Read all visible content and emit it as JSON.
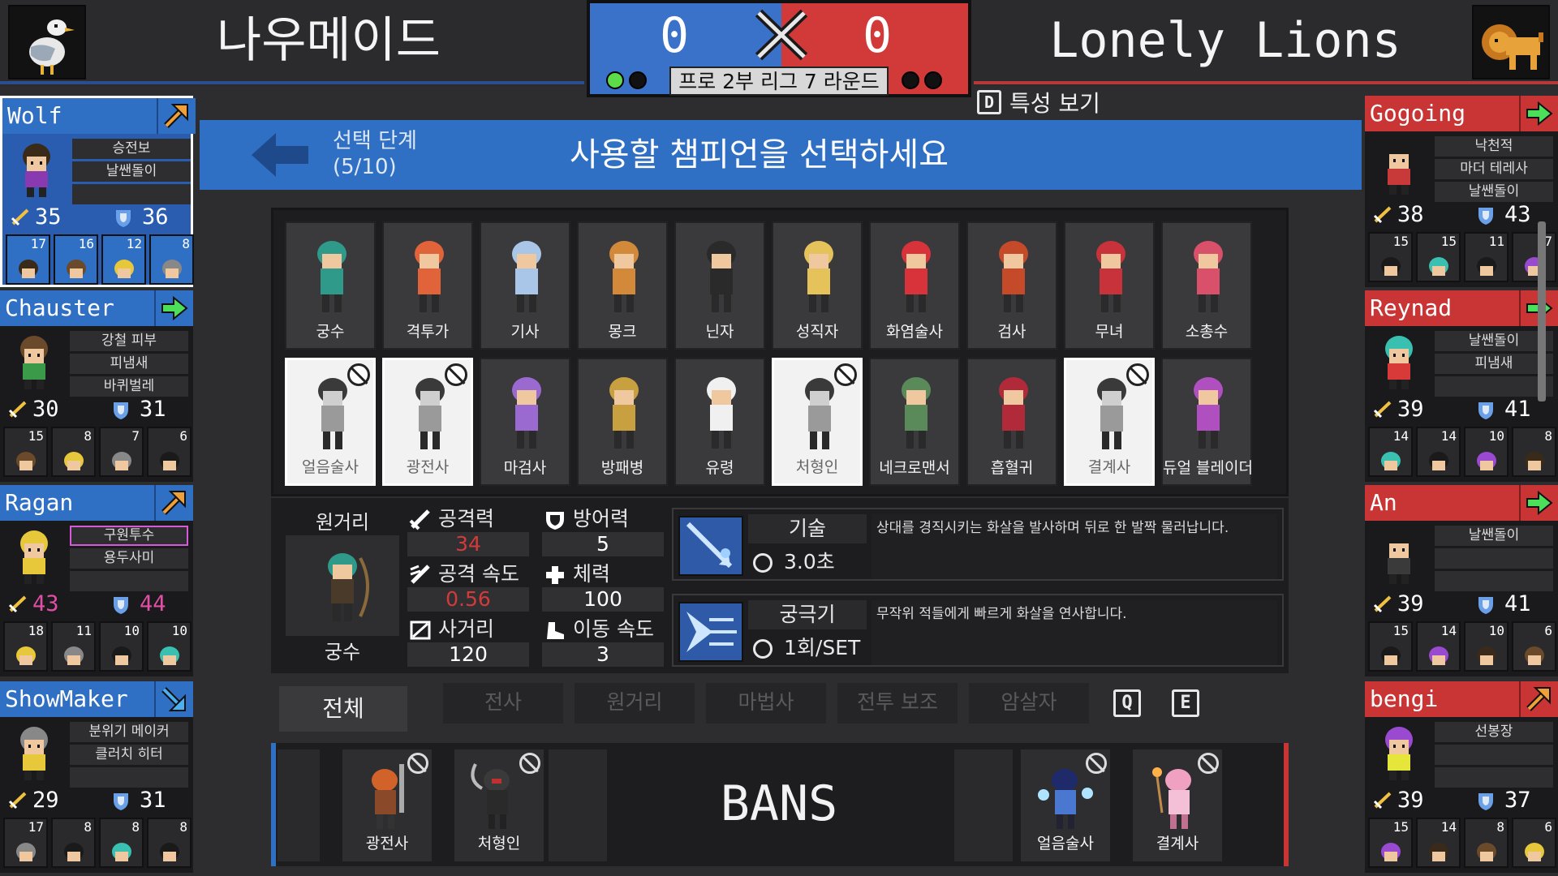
{
  "match": {
    "left_team": "나우메이드",
    "right_team": "Lonely Lions",
    "left_score": "0",
    "right_score": "0",
    "round_label": "프로 2부 리그 7 라운드",
    "traits_key": "D",
    "traits_label": "특성 보기",
    "colors": {
      "blue": "#2f6fc4",
      "red": "#c93535",
      "green_dot": "#5cdc4a"
    }
  },
  "header": {
    "phase_title": "선택 단계",
    "phase_progress": "(5/10)",
    "prompt": "사용할 챔피언을 선택하세요"
  },
  "left_players": [
    {
      "name": "Wolf",
      "status_icon": "arrow-up-right-icon",
      "traits": [
        "승전보",
        "날쌘돌이",
        ""
      ],
      "atk": "35",
      "def": "36",
      "champs": [
        "17",
        "16",
        "12",
        "8"
      ]
    },
    {
      "name": "Chauster",
      "status_icon": "arrow-right-icon",
      "traits": [
        "강철 피부",
        "피냄새",
        "바퀴벌레"
      ],
      "atk": "30",
      "def": "31",
      "champs": [
        "15",
        "8",
        "7",
        "6"
      ]
    },
    {
      "name": "Ragan",
      "status_icon": "arrow-up-right-icon",
      "traits": [
        "구원투수",
        "용두사미",
        ""
      ],
      "atk": "43",
      "def": "44",
      "champs": [
        "18",
        "11",
        "10",
        "10"
      ]
    },
    {
      "name": "ShowMaker",
      "status_icon": "arrow-down-right-icon",
      "traits": [
        "분위기 메이커",
        "클러치 히터",
        ""
      ],
      "atk": "29",
      "def": "31",
      "champs": [
        "17",
        "8",
        "8",
        "8"
      ]
    }
  ],
  "right_players": [
    {
      "name": "Gogoing",
      "status_icon": "arrow-right-icon",
      "traits": [
        "낙천적",
        "마더 테레사",
        "날쌘돌이"
      ],
      "atk": "38",
      "def": "43",
      "champs": [
        "15",
        "15",
        "11",
        "7"
      ]
    },
    {
      "name": "Reynad",
      "status_icon": "arrow-right-icon",
      "traits": [
        "날쌘돌이",
        "피냄새",
        ""
      ],
      "atk": "39",
      "def": "41",
      "champs": [
        "14",
        "14",
        "10",
        "8"
      ]
    },
    {
      "name": "An",
      "status_icon": "arrow-right-icon",
      "traits": [
        "날쌘돌이",
        "",
        ""
      ],
      "atk": "39",
      "def": "41",
      "champs": [
        "15",
        "14",
        "10",
        "6"
      ]
    },
    {
      "name": "bengi",
      "status_icon": "arrow-up-right-icon",
      "traits": [
        "선봉장",
        "",
        ""
      ],
      "atk": "39",
      "def": "37",
      "champs": [
        "15",
        "14",
        "8",
        "6"
      ]
    }
  ],
  "champions": [
    {
      "name": "궁수",
      "banned": false,
      "color": "#2f9a8a"
    },
    {
      "name": "격투가",
      "banned": false,
      "color": "#e0633a"
    },
    {
      "name": "기사",
      "banned": false,
      "color": "#a9c6e8"
    },
    {
      "name": "몽크",
      "banned": false,
      "color": "#d28a3a"
    },
    {
      "name": "닌자",
      "banned": false,
      "color": "#2a2a2a"
    },
    {
      "name": "성직자",
      "banned": false,
      "color": "#e6c25a"
    },
    {
      "name": "화염술사",
      "banned": false,
      "color": "#d8323a"
    },
    {
      "name": "검사",
      "banned": false,
      "color": "#c44a2a"
    },
    {
      "name": "무녀",
      "banned": false,
      "color": "#c8323a"
    },
    {
      "name": "소총수",
      "banned": false,
      "color": "#d8506a"
    },
    {
      "name": "얼음술사",
      "banned": true,
      "color": "#555555"
    },
    {
      "name": "광전사",
      "banned": true,
      "color": "#555555"
    },
    {
      "name": "마검사",
      "banned": false,
      "color": "#9a6ad0"
    },
    {
      "name": "방패병",
      "banned": false,
      "color": "#c8a040"
    },
    {
      "name": "유령",
      "banned": false,
      "color": "#f0f0f0"
    },
    {
      "name": "처형인",
      "banned": true,
      "color": "#555555"
    },
    {
      "name": "네크로맨서",
      "banned": false,
      "color": "#5a8a5a"
    },
    {
      "name": "흡혈귀",
      "banned": false,
      "color": "#b02a3a"
    },
    {
      "name": "결계사",
      "banned": true,
      "color": "#777777"
    },
    {
      "name": "듀얼 블레이더",
      "banned": false,
      "color": "#b050c0"
    }
  ],
  "detail": {
    "category": "원거리",
    "class_name": "궁수",
    "stats": {
      "atk_label": "공격력",
      "atk": "34",
      "def_label": "방어력",
      "def": "5",
      "aspd_label": "공격 속도",
      "aspd": "0.56",
      "hp_label": "체력",
      "hp": "100",
      "range_label": "사거리",
      "range": "120",
      "move_label": "이동 속도",
      "move": "3"
    },
    "skill": {
      "label": "기술",
      "cooldown": "3.0초",
      "desc": "상대를 경직시키는 화살을 발사하며 뒤로 한 발짝 물러납니다."
    },
    "ult": {
      "label": "궁극기",
      "cooldown": "1회/SET",
      "desc": "무작위 적들에게 빠르게 화살을 연사합니다."
    }
  },
  "filters": {
    "active": "전체",
    "tabs": [
      "전사",
      "원거리",
      "마법사",
      "전투 보조",
      "암살자"
    ],
    "key_prev": "Q",
    "key_next": "E"
  },
  "bans": {
    "label": "BANS",
    "left": [
      "광전사",
      "처형인"
    ],
    "right": [
      "얼음술사",
      "결계사"
    ]
  }
}
